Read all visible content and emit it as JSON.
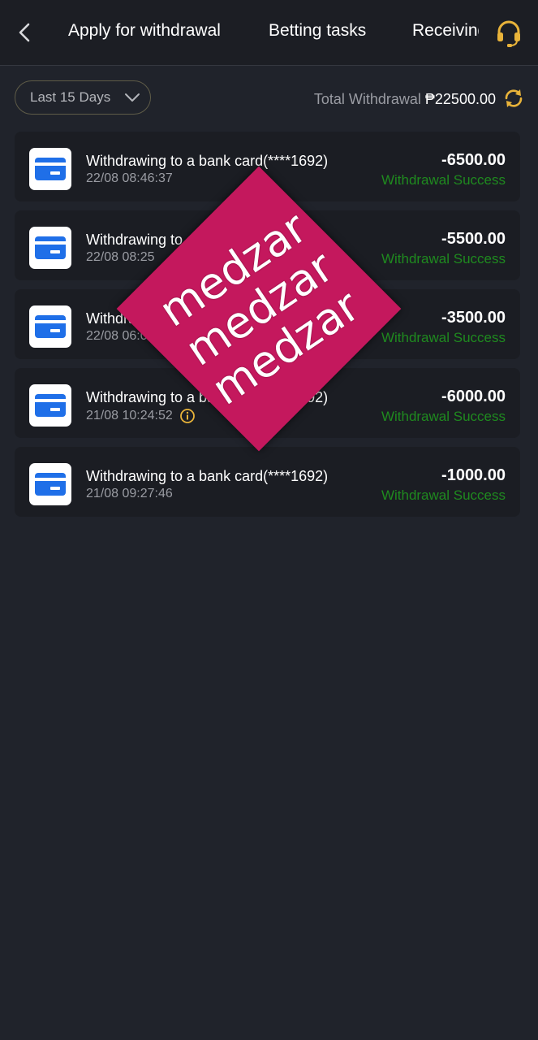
{
  "header": {
    "tabs": [
      "Apply for withdrawal",
      "Betting tasks",
      "Receiving"
    ],
    "back_icon": "chevron-left-icon",
    "support_icon": "headset-icon"
  },
  "filter": {
    "selected": "Last 15 Days"
  },
  "summary": {
    "label": "Total Withdrawal",
    "amount": "₱22500.00"
  },
  "transactions": [
    {
      "title": "Withdrawing to a bank card(****1692)",
      "time": "22/08 08:46:37",
      "amount": "-6500.00",
      "status": "Withdrawal Success",
      "info": false
    },
    {
      "title": "Withdrawing to a bank card(****1692)",
      "time": "22/08 08:25",
      "amount": "-5500.00",
      "status": "Withdrawal Success",
      "info": false
    },
    {
      "title": "Withdrawing to a bank card(****1692)",
      "time": "22/08 06:0",
      "amount": "-3500.00",
      "status": "Withdrawal Success",
      "info": false
    },
    {
      "title": "Withdrawing to a bank card(****1692)",
      "time": "21/08 10:24:52",
      "amount": "-6000.00",
      "status": "Withdrawal Success",
      "info": true
    },
    {
      "title": "Withdrawing to a bank card(****1692)",
      "time": "21/08 09:27:46",
      "amount": "-1000.00",
      "status": "Withdrawal Success",
      "info": false
    }
  ],
  "watermark": {
    "lines": [
      "medzar",
      "medzar",
      "medzar"
    ]
  },
  "colors": {
    "background": "#20232b",
    "accent": "#e8b33a",
    "success": "#1f8a1f",
    "card_icon": "#1f6fe8",
    "watermark": "#c4185d"
  }
}
